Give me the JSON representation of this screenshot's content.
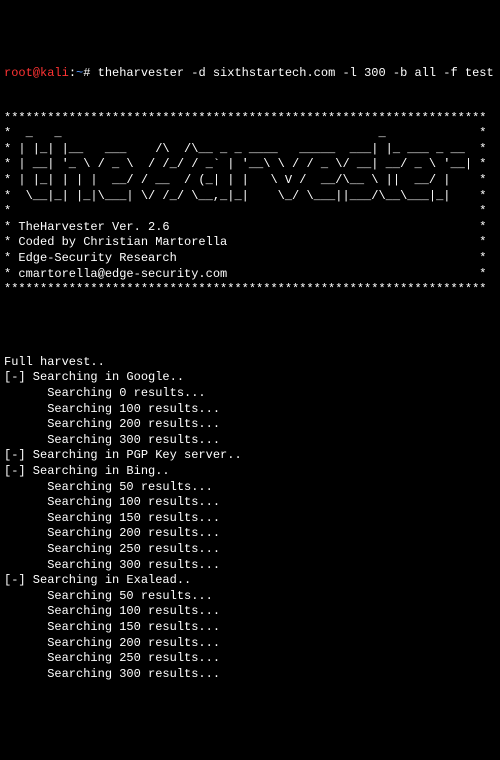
{
  "prompt": {
    "user": "root@kali",
    "sep1": ":",
    "path": "~",
    "sep2": "# ",
    "command": "theharvester -d sixthstartech.com -l 300 -b all -f test"
  },
  "border": "*******************************************************************",
  "ascii_art": [
    "*  _   _                                            _             *",
    "* | |_| |__   ___    /\\  /\\__ _ _ ____   _____  ___| |_ ___ _ __  *",
    "* | __| '_ \\ / _ \\  / /_/ / _` | '__\\ \\ / / _ \\/ __| __/ _ \\ '__| *",
    "* | |_| | | |  __/ / __  / (_| | |   \\ V /  __/\\__ \\ ||  __/ |    *",
    "*  \\__|_| |_|\\___| \\/ /_/ \\__,_|_|    \\_/ \\___||___/\\__\\___|_|    *",
    "*                                                                 *"
  ],
  "info": [
    "* TheHarvester Ver. 2.6                                           *",
    "* Coded by Christian Martorella                                   *",
    "* Edge-Security Research                                          *",
    "* cmartorella@edge-security.com                                   *"
  ],
  "output": {
    "header": "Full harvest..",
    "sections": [
      {
        "title": "[-] Searching in Google..",
        "lines": [
          "      Searching 0 results...",
          "      Searching 100 results...",
          "      Searching 200 results...",
          "      Searching 300 results..."
        ]
      },
      {
        "title": "[-] Searching in PGP Key server..",
        "lines": []
      },
      {
        "title": "[-] Searching in Bing..",
        "lines": [
          "      Searching 50 results...",
          "      Searching 100 results...",
          "      Searching 150 results...",
          "      Searching 200 results...",
          "      Searching 250 results...",
          "      Searching 300 results..."
        ]
      },
      {
        "title": "[-] Searching in Exalead..",
        "lines": [
          "      Searching 50 results...",
          "      Searching 100 results...",
          "      Searching 150 results...",
          "      Searching 200 results...",
          "      Searching 250 results...",
          "      Searching 300 results..."
        ]
      }
    ]
  }
}
